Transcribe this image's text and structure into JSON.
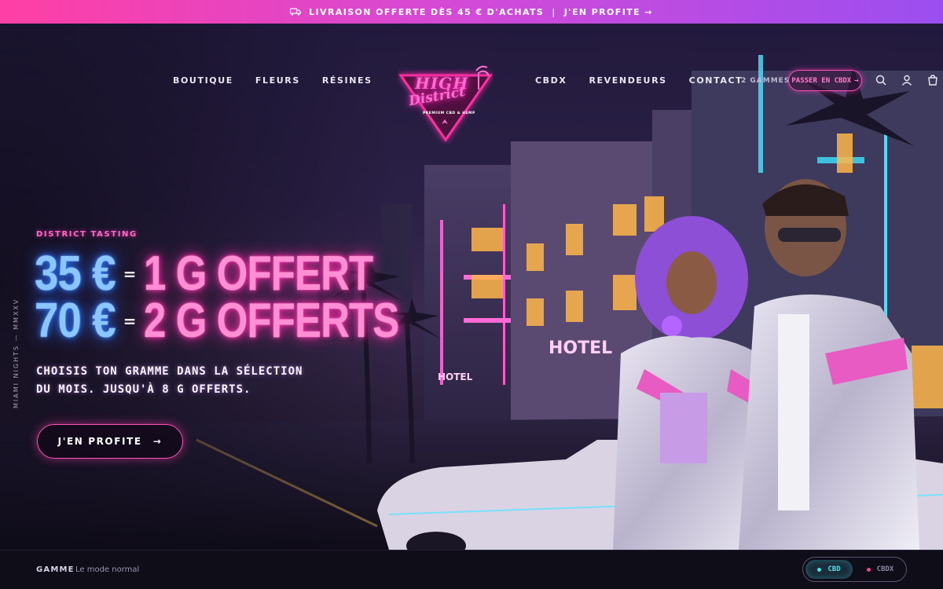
{
  "announcement": {
    "text": "LIVRAISON OFFERTE DÈS 45 € D'ACHATS",
    "separator": "|",
    "link": "J'EN PROFITE →"
  },
  "nav": {
    "left": [
      "BOUTIQUE",
      "FLEURS",
      "RÉSINES"
    ],
    "right": [
      "CBDX",
      "REVENDEURS",
      "CONTACT"
    ]
  },
  "logo": {
    "line1": "HIGH",
    "line2": "District",
    "tagline": "PREMIUM CBD & HEMP"
  },
  "header": {
    "gammes_count": "2 GAMMES",
    "switch_label": "PASSER EN CBDX",
    "switch_arrow": "→",
    "icons": [
      "search-icon",
      "account-icon",
      "cart-icon"
    ]
  },
  "hero": {
    "eyebrow": "DISTRICT TASTING",
    "offers": [
      {
        "price": "35 €",
        "eq": "=",
        "gift": "1 G OFFERT"
      },
      {
        "price": "70 €",
        "eq": "=",
        "gift": "2 G OFFERTS"
      }
    ],
    "subtitle": "CHOISIS TON GRAMME DANS LA SÉLECTION DU MOIS. JUSQU'À 8 G OFFERTS.",
    "cta_label": "J'EN PROFITE",
    "cta_arrow": "→",
    "side_tag": "MIAMI NIGHTS — MMXXV",
    "sign_hotel_large": "HOTEL",
    "sign_hotel_small": "HOTEL"
  },
  "bottom_bar": {
    "label": "GAMME",
    "mode": "Le mode normal",
    "options": [
      {
        "label": "CBD",
        "active": true,
        "color": "#4fe0f0"
      },
      {
        "label": "CBDX",
        "active": false,
        "color": "#ff3f8a"
      }
    ]
  },
  "colors": {
    "accent_pink": "#ff4fb8",
    "accent_blue": "#8cc6ff",
    "accent_cyan": "#4fe0f0"
  }
}
